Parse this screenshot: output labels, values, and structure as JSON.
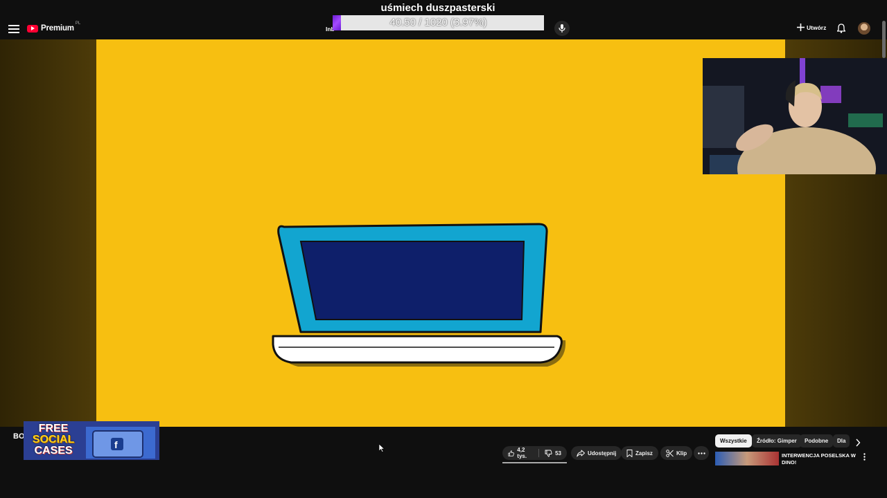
{
  "overlay": {
    "title": "uśmiech duszpasterski",
    "progress_text": "40.50 / 1020 (3.97%)",
    "progress_fraction": 0.0397,
    "fill_color": "#8a2be2"
  },
  "header": {
    "logo_text": "Premium",
    "logo_region": "PL",
    "search_stub": "Inb",
    "create_label": "Utwórz",
    "icons": [
      "menu-icon",
      "youtube-logo-icon",
      "mic-icon",
      "plus-icon",
      "bell-icon",
      "avatar"
    ]
  },
  "video": {
    "background_color": "#f7bf11",
    "laptop_colors": {
      "frame": "#12a5d0",
      "screen": "#0e1f6a",
      "base": "#ffffff"
    }
  },
  "bottom": {
    "channel_stub": "BO",
    "ad": {
      "line1": "FREE",
      "line2": "SOCIAL",
      "line3": "CASES"
    },
    "likes": "4,2 tys.",
    "dislikes": "53",
    "share_label": "Udostępnij",
    "save_label": "Zapisz",
    "clip_label": "Klip",
    "chips": [
      "Wszystkie",
      "Źródło: Gimper",
      "Podobne",
      "Dla"
    ],
    "recommended_title": "INTERWENCJA POSELSKA W DINO!"
  }
}
